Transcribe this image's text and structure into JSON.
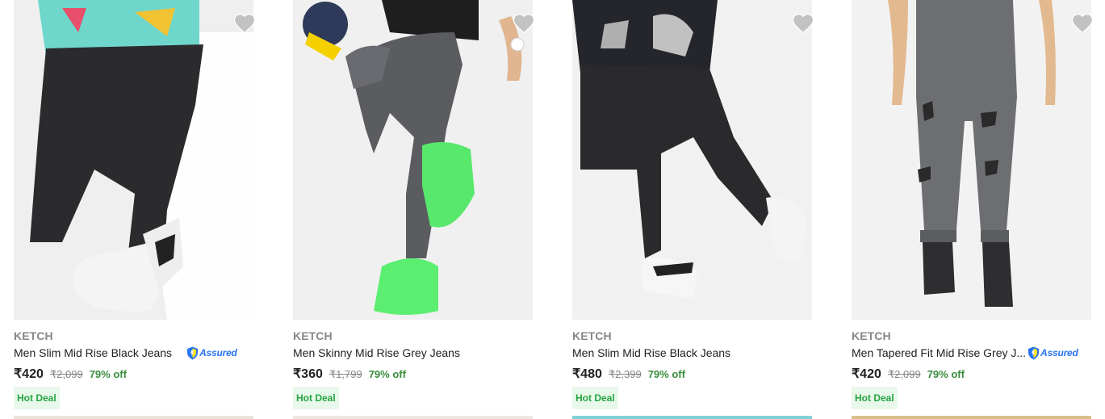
{
  "products": [
    {
      "brand": "KETCH",
      "title": "Men Slim Mid Rise Black Jeans",
      "assured": true,
      "assured_label": "Assured",
      "price": "₹420",
      "mrp": "₹2,099",
      "discount": "79% off",
      "deal": "Hot Deal",
      "image_icon": "black-jeans-photo",
      "jeans_color": "#2b2b2d",
      "bg_color": "#efefef"
    },
    {
      "brand": "KETCH",
      "title": "Men Skinny Mid Rise Grey Jeans",
      "assured": false,
      "price": "₹360",
      "mrp": "₹1,799",
      "discount": "79% off",
      "deal": "Hot Deal",
      "image_icon": "grey-jeans-photo",
      "jeans_color": "#5b5c60",
      "bg_color": "#f0f0f0"
    },
    {
      "brand": "KETCH",
      "title": "Men Slim Mid Rise Black Jeans",
      "assured": false,
      "price": "₹480",
      "mrp": "₹2,399",
      "discount": "79% off",
      "deal": "Hot Deal",
      "image_icon": "black-jeans-photo",
      "jeans_color": "#2a2a2c",
      "bg_color": "#f1f1f1"
    },
    {
      "brand": "KETCH",
      "title": "Men Tapered Fit Mid Rise Grey J...",
      "assured": true,
      "assured_label": "Assured",
      "price": "₹420",
      "mrp": "₹2,099",
      "discount": "79% off",
      "deal": "Hot Deal",
      "image_icon": "grey-jeans-photo",
      "jeans_color": "#6d6e72",
      "bg_color": "#f2f2f2"
    }
  ],
  "colors": {
    "wishlist_heart": "#c2c2c2",
    "assured_blue": "#2874f0",
    "discount_green": "#388e3c",
    "deal_bg": "#e8f8ea",
    "deal_text": "#26a541"
  }
}
